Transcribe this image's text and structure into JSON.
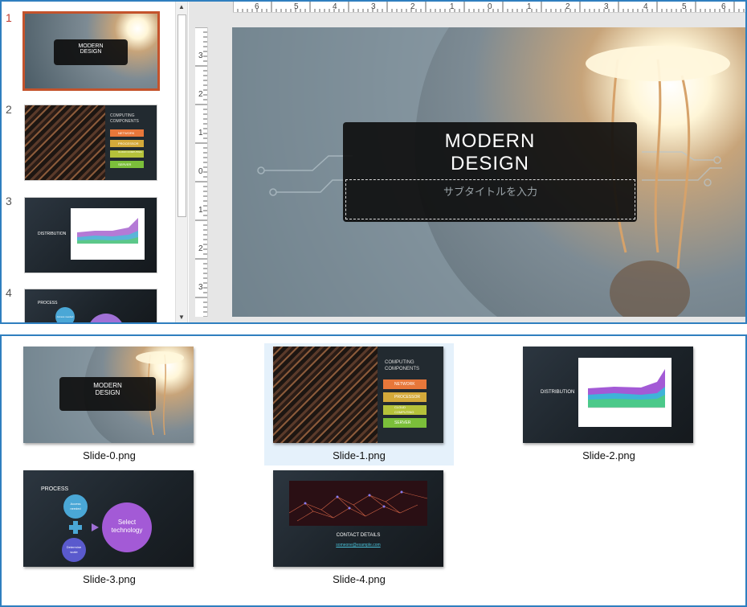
{
  "editor": {
    "slide_numbers": [
      "1",
      "2",
      "3",
      "4"
    ],
    "h_ruler_labels": [
      "6",
      "5",
      "4",
      "3",
      "2",
      "1",
      "0",
      "1",
      "2",
      "3",
      "4",
      "5",
      "6"
    ],
    "v_ruler_labels": [
      "3",
      "2",
      "1",
      "0",
      "1",
      "2",
      "3"
    ],
    "thumbnails": {
      "slide1": {
        "title_line1": "MODERN",
        "title_line2": "DESIGN"
      },
      "slide2": {
        "heading_line1": "COMPUTING",
        "heading_line2": "COMPONENTS",
        "items": [
          "NETWORK",
          "PROCESSOR",
          "CLOUD COMPUTING",
          "SERVER"
        ]
      },
      "slide3": {
        "title": "DISTRIBUTION"
      },
      "slide4": {
        "title": "PROCESS",
        "bubble1": "Access needed"
      }
    },
    "main_slide": {
      "title_line1": "MODERN",
      "title_line2": "DESIGN",
      "subtitle_placeholder": "サブタイトルを入力"
    },
    "accent": "#c4532c"
  },
  "explorer": {
    "files": [
      {
        "name": "Slide-0.png"
      },
      {
        "name": "Slide-1.png"
      },
      {
        "name": "Slide-2.png"
      },
      {
        "name": "Slide-3.png"
      },
      {
        "name": "Slide-4.png"
      }
    ],
    "slide0": {
      "title_line1": "MODERN",
      "title_line2": "DESIGN"
    },
    "slide1": {
      "heading_line1": "COMPUTING",
      "heading_line2": "COMPONENTS",
      "items": [
        "NETWORK",
        "PROCESSOR",
        "CLOUD",
        "SERVER"
      ],
      "cloud_line2": "COMPUTING"
    },
    "slide2": {
      "title": "DISTRIBUTION"
    },
    "slide3": {
      "title": "PROCESS",
      "bubble_access_l1": "Access",
      "bubble_access_l2": "needed",
      "bubble_select_l1": "Select",
      "bubble_select_l2": "technology",
      "bubble_determine_l1": "Determine",
      "bubble_determine_l2": "scale"
    },
    "slide4": {
      "title": "CONTACT DETAILS",
      "email": "someone@example.com"
    },
    "selected_index": 1
  }
}
